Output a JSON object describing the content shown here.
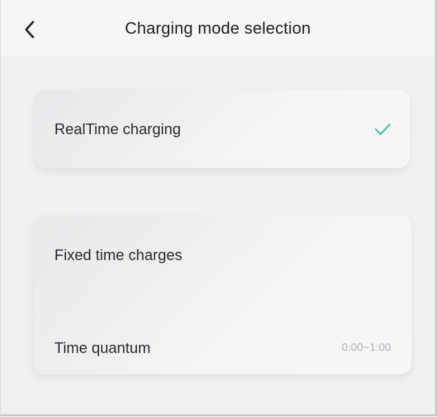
{
  "header": {
    "title": "Charging mode selection"
  },
  "options": {
    "realtime": {
      "label": "RealTime charging",
      "selected": true
    },
    "fixed": {
      "label": "Fixed time charges",
      "time_quantum": {
        "label": "Time quantum",
        "value": "0:00~1:00"
      }
    }
  },
  "colors": {
    "accent_check": "#4bbfae",
    "text_primary": "#2a2a30",
    "text_muted": "#b0b0b6"
  },
  "icons": {
    "back": "chevron-left-icon",
    "check": "check-icon"
  }
}
